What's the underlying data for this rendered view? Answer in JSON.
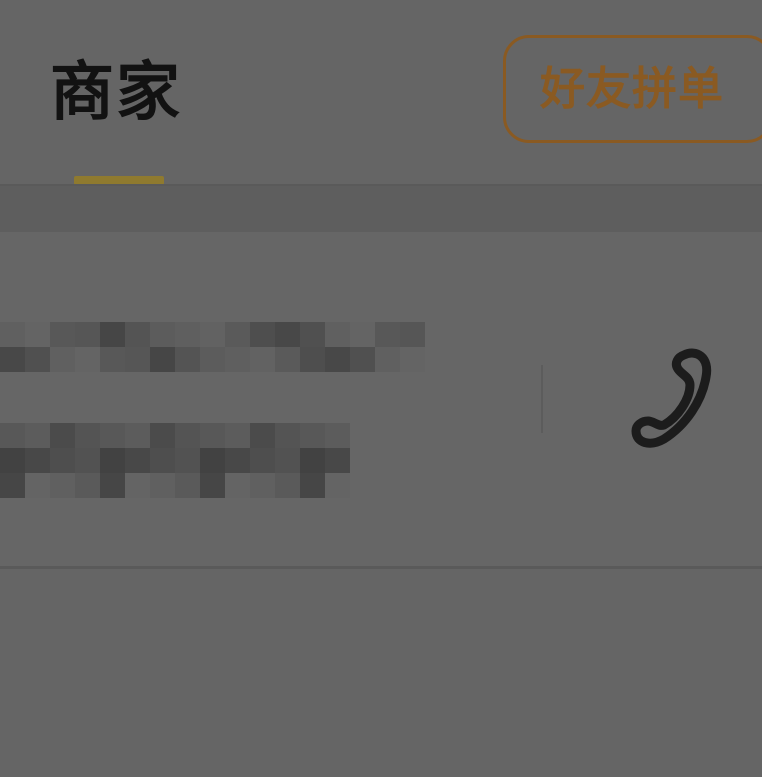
{
  "tabs": {
    "merchant_label": "商家"
  },
  "actions": {
    "group_order_label": "好友拼单"
  },
  "merchant_info": {
    "contact_icon": "phone-icon"
  },
  "colors": {
    "overlay_bg": "#656565",
    "tab_underline": "#8f7a2f",
    "group_order_accent": "#8a5a22",
    "text_dark": "#121212"
  }
}
